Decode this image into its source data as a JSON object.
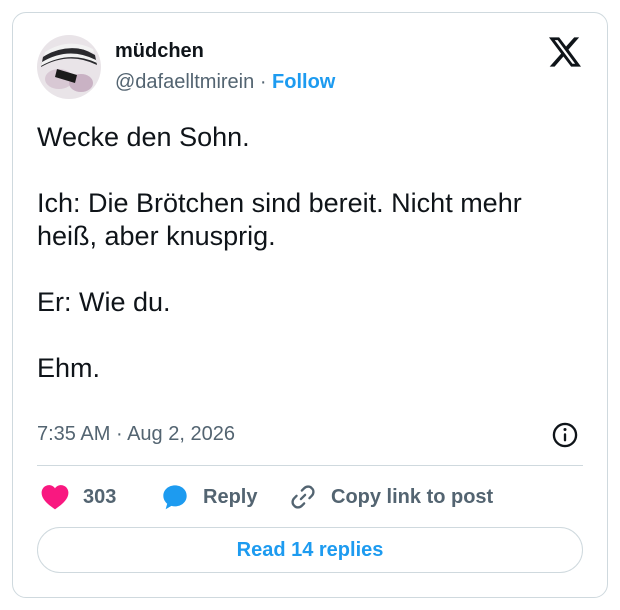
{
  "author": {
    "display_name": "müdchen",
    "handle": "@dafaelltmirein",
    "separator": "·",
    "follow_label": "Follow"
  },
  "tweet": {
    "paragraphs": [
      "Wecke den Sohn.",
      "Ich: Die Brötchen sind bereit. Nicht mehr heiß, aber knusprig.",
      "Er: Wie du.",
      "Ehm."
    ],
    "time": "7:35 AM",
    "date_separator": "·",
    "date": "Aug 2, 2026"
  },
  "actions": {
    "like_count": "303",
    "reply_label": "Reply",
    "copy_label": "Copy link to post"
  },
  "footer": {
    "read_replies_label": "Read 14 replies"
  },
  "icons": {
    "logo": "x-logo-icon",
    "info": "info-icon",
    "like": "heart-icon",
    "reply": "speech-bubble-icon",
    "copy": "link-icon"
  },
  "colors": {
    "accent": "#1d9bf0",
    "like": "#f91880",
    "text": "#0f1419",
    "secondary": "#536471",
    "border": "#cfd9de"
  }
}
